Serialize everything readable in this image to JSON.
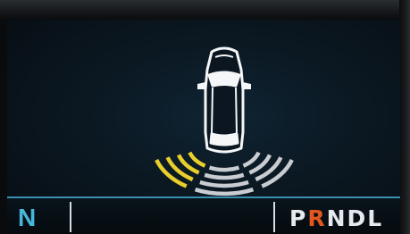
{
  "display": {
    "current_gear_letter": "N",
    "gear_selector": [
      "P",
      "R",
      "N",
      "D",
      "L"
    ],
    "active_gear_index": 1
  },
  "park_assist": {
    "vehicle_icon": "car-top-view-icon",
    "rear_left_zone": {
      "state": "warning",
      "color": "#e8cf2b"
    },
    "rear_center_zone": {
      "state": "clear",
      "color": "#c9cdd2"
    },
    "rear_right_zone": {
      "state": "clear",
      "color": "#c9cdd2"
    }
  },
  "colors": {
    "accent": "#45b7d8",
    "active_gear": "#e2561f",
    "warning": "#e8cf2b",
    "clear": "#c9cdd2"
  }
}
